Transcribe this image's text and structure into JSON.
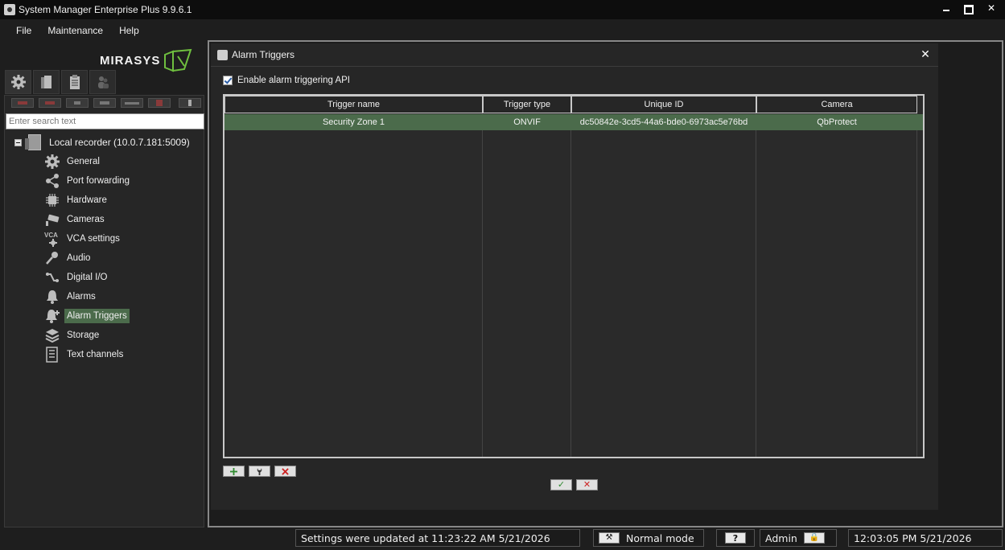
{
  "window": {
    "title": "System Manager Enterprise Plus 9.9.6.1"
  },
  "menu": {
    "items": [
      "File",
      "Maintenance",
      "Help"
    ]
  },
  "brand": {
    "logo_text": "MIRASYS",
    "accent": "#6fbf3f"
  },
  "left": {
    "tabs": [
      "settings-gear",
      "recorder",
      "clipboard",
      "users"
    ],
    "search_placeholder": "Enter search text",
    "root": "Local recorder (10.0.7.181:5009)",
    "items": [
      {
        "label": "General",
        "icon": "gear-icon"
      },
      {
        "label": "Port forwarding",
        "icon": "share-icon"
      },
      {
        "label": "Hardware",
        "icon": "chip-icon"
      },
      {
        "label": "Cameras",
        "icon": "camera-icon"
      },
      {
        "label": "VCA settings",
        "icon": "vca-icon"
      },
      {
        "label": "Audio",
        "icon": "microphone-icon"
      },
      {
        "label": "Digital I/O",
        "icon": "digital-io-icon"
      },
      {
        "label": "Alarms",
        "icon": "bell-icon"
      },
      {
        "label": "Alarm Triggers",
        "icon": "bell-plus-icon"
      },
      {
        "label": "Storage",
        "icon": "layers-icon"
      },
      {
        "label": "Text channels",
        "icon": "list-icon"
      }
    ],
    "selected": "Alarm Triggers"
  },
  "dialog": {
    "title": "Alarm Triggers",
    "enable_label": "Enable alarm triggering API",
    "enable_checked": true,
    "columns": [
      "Trigger name",
      "Trigger type",
      "Unique ID",
      "Camera"
    ],
    "rows": [
      {
        "name": "Security Zone 1",
        "type": "ONVIF",
        "id": "dc50842e-3cd5-44a6-bde0-6973ac5e76bd",
        "camera": "QbProtect"
      }
    ],
    "selected_color": "#4b6b4b"
  },
  "status": {
    "message": "Settings were updated at 11:23:22 AM 5/21/2026",
    "mode": "Normal mode",
    "help": "?",
    "user": "Admin",
    "clock": "12:03:05 PM 5/21/2026"
  }
}
